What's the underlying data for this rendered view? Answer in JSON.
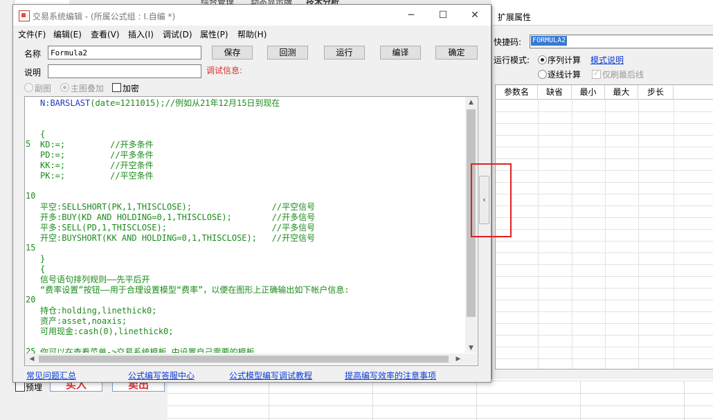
{
  "background": {
    "top_tabs": [
      "综合管理",
      "动态显示牌",
      "技术分析"
    ],
    "buy_button": "买入",
    "sell_button": "卖出",
    "prefill_label": "预埋"
  },
  "editor": {
    "title": "交易系统编辑 - (所属公式组 : I.自编 *)",
    "menu": [
      "文件(F)",
      "编辑(E)",
      "查看(V)",
      "插入(I)",
      "调试(D)",
      "属性(P)",
      "帮助(H)"
    ],
    "name_label": "名称",
    "name_value": "Formula2",
    "desc_label": "说明",
    "desc_value": "",
    "debug_info": "调试信息:",
    "buttons": {
      "save": "保存",
      "backtest": "回测",
      "run": "运行",
      "compile": "编译",
      "ok": "确定"
    },
    "options": {
      "sub_chart": "副图",
      "main_overlay": "主图叠加",
      "encrypt": "加密"
    },
    "line_numbers": [
      "5",
      "10",
      "15",
      "20",
      "25"
    ],
    "code": {
      "l1_prefix": "N:",
      "l1_fn": "BARSLAST",
      "l1_rest": "(date=1211015);//例如从21年12月15日到现在",
      "l4": "{",
      "l5": "KD:=;         //开多条件",
      "l6": "PD:=;         //平多条件",
      "l7": "KK:=;         //开空条件",
      "l8": "PK:=;         //平空条件",
      "l11": "平空:SELLSHORT(PK,1,THISCLOSE);                //平空信号",
      "l12": "开多:BUY(KD AND HOLDING=0,1,THISCLOSE);        //开多信号",
      "l13": "平多:SELL(PD,1,THISCLOSE);                     //平多信号",
      "l14": "开空:BUYSHORT(KK AND HOLDING=0,1,THISCLOSE);   //开空信号",
      "l16": "}",
      "l17": "{",
      "l18": "信号语句排列规则——先平后开",
      "l19": "“费率设置”按钮——用于合理设置模型“费率”，以便在图形上正确输出如下帐户信息:",
      "l21": "持仓:holding,linethick0;",
      "l22": "资产:asset,noaxis;",
      "l23": "可用现金:cash(0),linethick0;",
      "l25": "你可以在查看菜单->交易系统模板 中设置自己需要的模板"
    },
    "links": [
      "常见问题汇总",
      "公式编写答服中心",
      "公式模型编写调试教程",
      "提高编写效率的注意事项"
    ]
  },
  "ext_panel": {
    "title": "扩展属性",
    "quick_code_label": "快捷码:",
    "quick_code_value": "FORMULA2",
    "run_mode_label": "运行模式:",
    "mode_sequence": "序列计算",
    "mode_link": "模式说明",
    "mode_tick": "逐线计算",
    "only_last_tick": "仅刷最后线",
    "table_headers": [
      "参数名",
      "缺省",
      "最小",
      "最大",
      "步长"
    ]
  },
  "colors": {
    "code_green": "#1a8a1a",
    "code_blue": "#1d3bbd",
    "link_blue": "#0b3bd6",
    "debug_red": "#e03030",
    "highlight_red": "#e02020"
  }
}
